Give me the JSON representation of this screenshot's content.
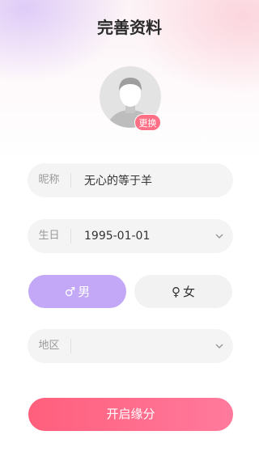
{
  "header": {
    "title": "完善资料"
  },
  "avatar": {
    "change_label": "更换"
  },
  "form": {
    "nickname": {
      "label": "昵称",
      "value": "无心的等于羊"
    },
    "birthday": {
      "label": "生日",
      "value": "1995-01-01"
    },
    "gender": {
      "male": {
        "symbol": "♂",
        "label": "男",
        "selected": true
      },
      "female": {
        "symbol": "♀",
        "label": "女",
        "selected": false
      }
    },
    "region": {
      "label": "地区",
      "value": ""
    }
  },
  "submit": {
    "label": "开启缘分"
  },
  "colors": {
    "accent_pink": "#ff6f86",
    "selected_gender": "#c3a8f8",
    "field_bg": "#f4f4f4"
  },
  "icons": {
    "avatar": "default-person-icon",
    "dropdown": "chevron-down-icon"
  }
}
